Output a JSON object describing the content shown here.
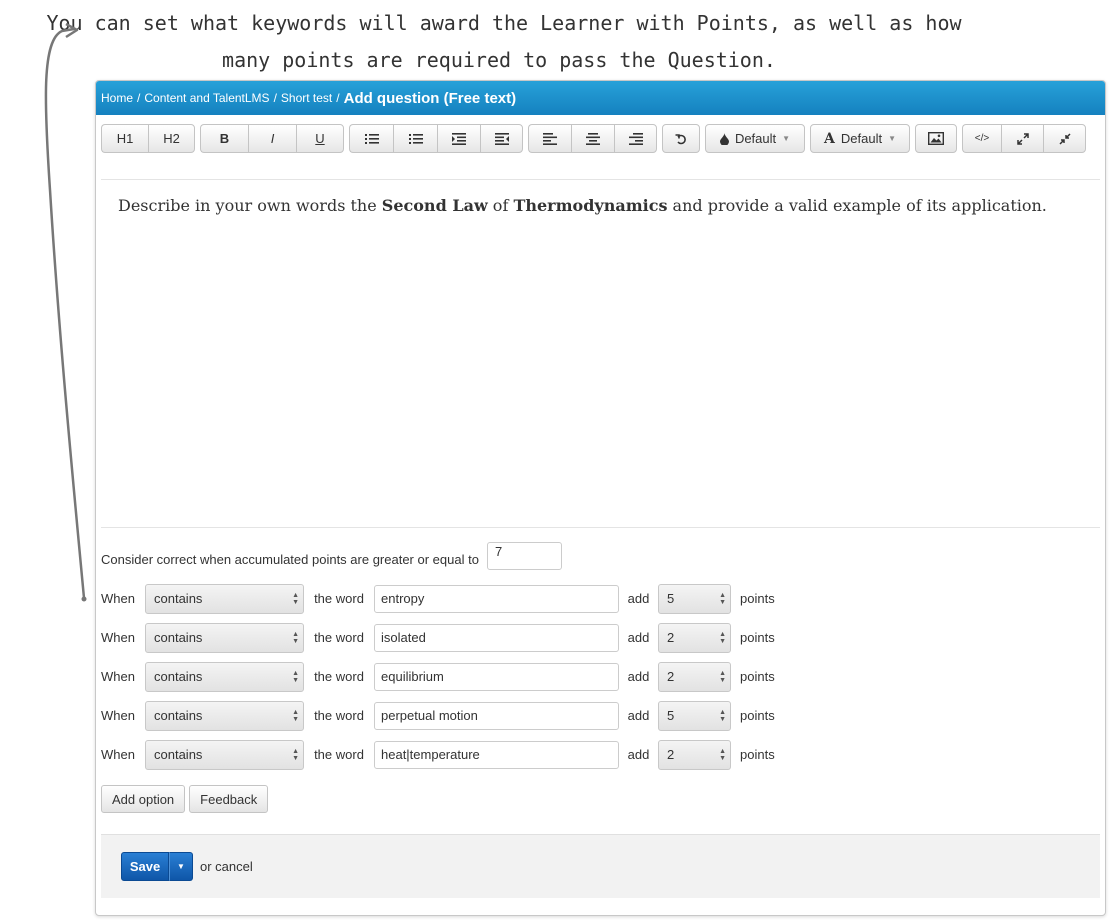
{
  "annotation": {
    "line1": "You can set what keywords will award the Learner with Points, as well as how",
    "line2": "many points are required to pass the Question."
  },
  "breadcrumb": {
    "home": "Home",
    "category": "Content and TalentLMS",
    "course": "Short test",
    "separator": "/",
    "title": "Add question (Free text)"
  },
  "toolbar": {
    "h1": "H1",
    "h2": "H2",
    "bold": "B",
    "italic": "I",
    "underline": "U",
    "color_dropdown": "Default",
    "font_dropdown": "Default",
    "font_icon_glyph": "A"
  },
  "editor": {
    "text_before": "Describe in your own words the ",
    "bold1": "Second Law",
    "text_middle": " of ",
    "bold2": "Thermodynamics",
    "text_after": " and provide a valid example of its application."
  },
  "threshold": {
    "label": "Consider correct when accumulated points are greater or equal to",
    "value": "7"
  },
  "rules": [
    {
      "when": "When",
      "operator": "contains",
      "the_word": "the word",
      "word": "entropy",
      "add": "add",
      "points": "5",
      "points_label": "points"
    },
    {
      "when": "When",
      "operator": "contains",
      "the_word": "the word",
      "word": "isolated",
      "add": "add",
      "points": "2",
      "points_label": "points"
    },
    {
      "when": "When",
      "operator": "contains",
      "the_word": "the word",
      "word": "equilibrium",
      "add": "add",
      "points": "2",
      "points_label": "points"
    },
    {
      "when": "When",
      "operator": "contains",
      "the_word": "the word",
      "word": "perpetual motion",
      "add": "add",
      "points": "5",
      "points_label": "points"
    },
    {
      "when": "When",
      "operator": "contains",
      "the_word": "the word",
      "word": "heat|temperature",
      "add": "add",
      "points": "2",
      "points_label": "points"
    }
  ],
  "actions": {
    "add_option": "Add option",
    "feedback": "Feedback"
  },
  "footer": {
    "save": "Save",
    "or_cancel": "or cancel"
  },
  "colors": {
    "header_blue": "#1a8ccc",
    "save_blue": "#1565b8"
  }
}
